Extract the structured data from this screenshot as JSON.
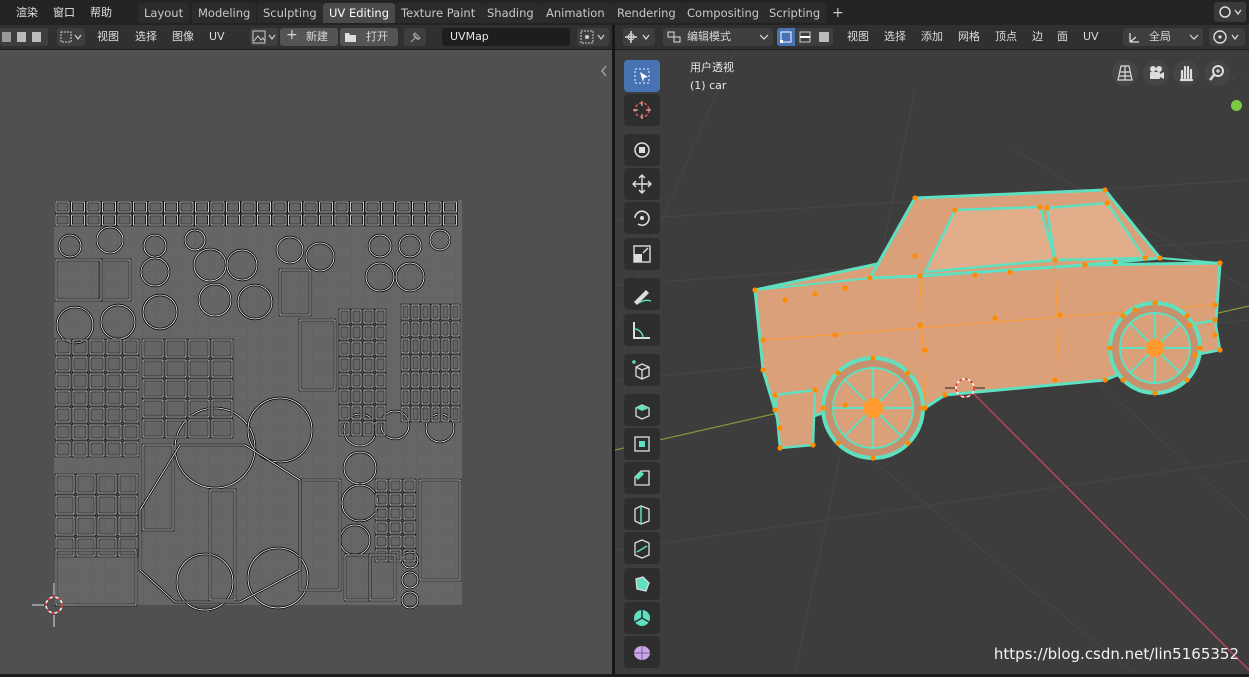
{
  "topbar": {
    "menus": [
      "渲染",
      "窗口",
      "帮助"
    ],
    "tabs": [
      "Layout",
      "Modeling",
      "Sculpting",
      "UV Editing",
      "Texture Paint",
      "Shading",
      "Animation",
      "Rendering",
      "Compositing",
      "Scripting"
    ],
    "active_tab": "UV Editing",
    "add_tab": "+"
  },
  "uv_header": {
    "menus": [
      "视图",
      "选择",
      "图像",
      "UV"
    ],
    "new_label": "新建",
    "open_label": "打开",
    "uvmap_name": "UVMap"
  },
  "viewport_header": {
    "mode": "编辑模式",
    "menus": [
      "视图",
      "选择",
      "添加",
      "网格",
      "顶点",
      "边",
      "面",
      "UV"
    ],
    "orientation": "全局"
  },
  "viewport": {
    "perspective_label": "用户透视",
    "object_label": "(1) car"
  },
  "tools": [
    "select-box",
    "cursor",
    "move",
    "move-arrows",
    "rotate",
    "scale",
    "annotate",
    "measure",
    "add-cube",
    "extrude",
    "inset",
    "bevel",
    "loop-cut",
    "knife",
    "poly-build",
    "spin",
    "smooth"
  ],
  "colors": {
    "accent": "#4772b3",
    "edge": "#5fe0c0",
    "vertex": "#ff8c00",
    "face": "#e8a57a"
  },
  "watermark": "https://blog.csdn.net/lin5165352"
}
